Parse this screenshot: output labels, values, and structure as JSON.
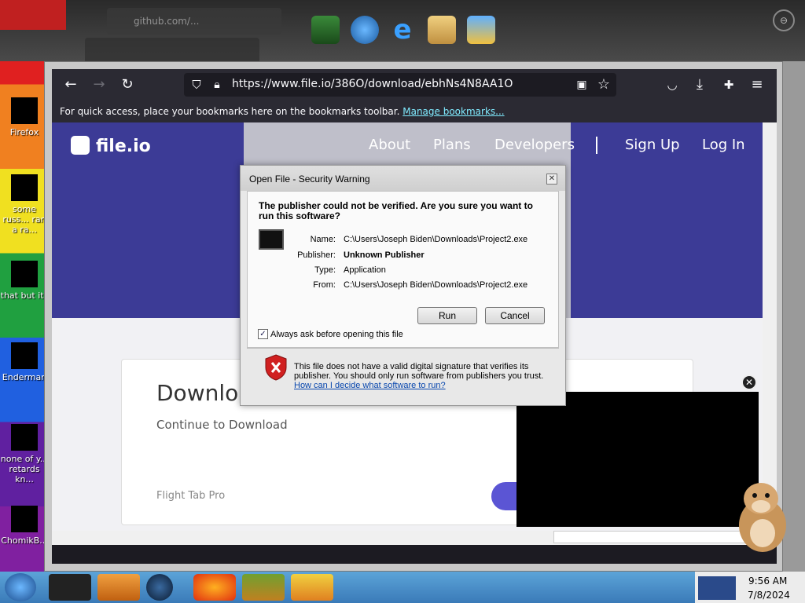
{
  "desktop": {
    "icons": [
      {
        "label": "Firefox"
      },
      {
        "label": "some russ... ran a ra..."
      },
      {
        "label": "that but its"
      },
      {
        "label": "Enderman"
      },
      {
        "label": "none of y... retards kn..."
      },
      {
        "label": "ChomikB..."
      }
    ]
  },
  "ghost": {
    "tab_text": "github.com/...",
    "close_icon": "close-icon"
  },
  "browser": {
    "url": "https://www.file.io/386O/download/ebhNs4N8AA1O",
    "bookmarks_text": "For quick access, place your bookmarks here on the bookmarks toolbar.",
    "bookmarks_link": "Manage bookmarks..."
  },
  "page": {
    "logo": "file.io",
    "nav": [
      "About",
      "Plans",
      "Developers",
      "Sign Up",
      "Log In"
    ],
    "card_title": "Downloa",
    "card_subtitle": "Continue to Download",
    "card_footer": "Flight Tab Pro"
  },
  "dialog": {
    "title": "Open File - Security Warning",
    "question": "The publisher could not be verified.  Are you sure you want to run this software?",
    "fields": [
      {
        "label": "Name:",
        "value": "C:\\Users\\Joseph Biden\\Downloads\\Project2.exe"
      },
      {
        "label": "Publisher:",
        "value": "Unknown Publisher"
      },
      {
        "label": "Type:",
        "value": "Application"
      },
      {
        "label": "From:",
        "value": "C:\\Users\\Joseph Biden\\Downloads\\Project2.exe"
      }
    ],
    "run_label": "Run",
    "cancel_label": "Cancel",
    "checkbox_label": "Always ask before opening this file",
    "checkbox_checked": "✓",
    "warning_text": "This file does not have a valid digital signature that verifies its publisher.  You should only run software from publishers you trust.",
    "warning_link": "How can I decide what software to run?"
  },
  "video": {
    "close": "✕"
  },
  "taskbar": {
    "time": "9:56 AM",
    "date": "7/8/2024"
  },
  "colors": {
    "browser_chrome": "#2b2a33",
    "fileio_brand": "#3c3b96",
    "taskbar": "#3a7ab8"
  }
}
